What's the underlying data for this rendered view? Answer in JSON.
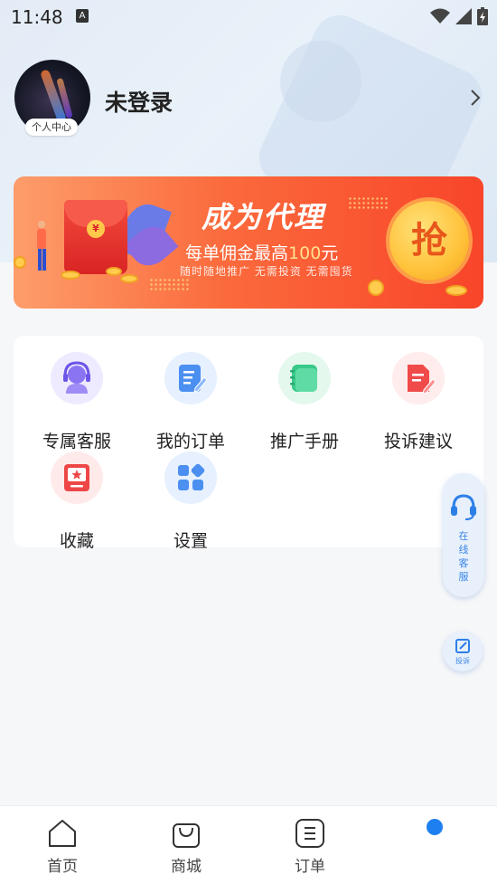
{
  "status_bar": {
    "time": "11:48",
    "notification_badge": "A",
    "icons": [
      "wifi-icon",
      "signal-icon",
      "battery-charging-icon"
    ]
  },
  "profile": {
    "tag": "个人中心",
    "username": "未登录"
  },
  "banner": {
    "title": "成为代理",
    "subtitle_prefix": "每单佣金最高",
    "subtitle_amount": "100",
    "subtitle_unit": "元",
    "note": "随时随地推广  无需投资  无需囤货",
    "grab_label": "抢",
    "envelope_symbol": "¥"
  },
  "menu": {
    "items": [
      {
        "label": "专属客服",
        "icon": "customer-service-icon"
      },
      {
        "label": "我的订单",
        "icon": "order-edit-icon"
      },
      {
        "label": "推广手册",
        "icon": "manual-icon"
      },
      {
        "label": "投诉建议",
        "icon": "complaint-icon"
      },
      {
        "label": "收藏",
        "icon": "favorite-icon"
      },
      {
        "label": "设置",
        "icon": "settings-icon"
      }
    ]
  },
  "floating": {
    "cs_label": "在\n线\n客\n服",
    "complain_label": "投诉"
  },
  "bottom_nav": {
    "items": [
      {
        "label": "首页",
        "icon": "home-icon"
      },
      {
        "label": "商城",
        "icon": "shopping-bag-icon"
      },
      {
        "label": "订单",
        "icon": "order-icon"
      }
    ]
  },
  "colors": {
    "accent_blue": "#1e80f0",
    "banner_start": "#fd9d6b",
    "banner_end": "#f8452a"
  }
}
